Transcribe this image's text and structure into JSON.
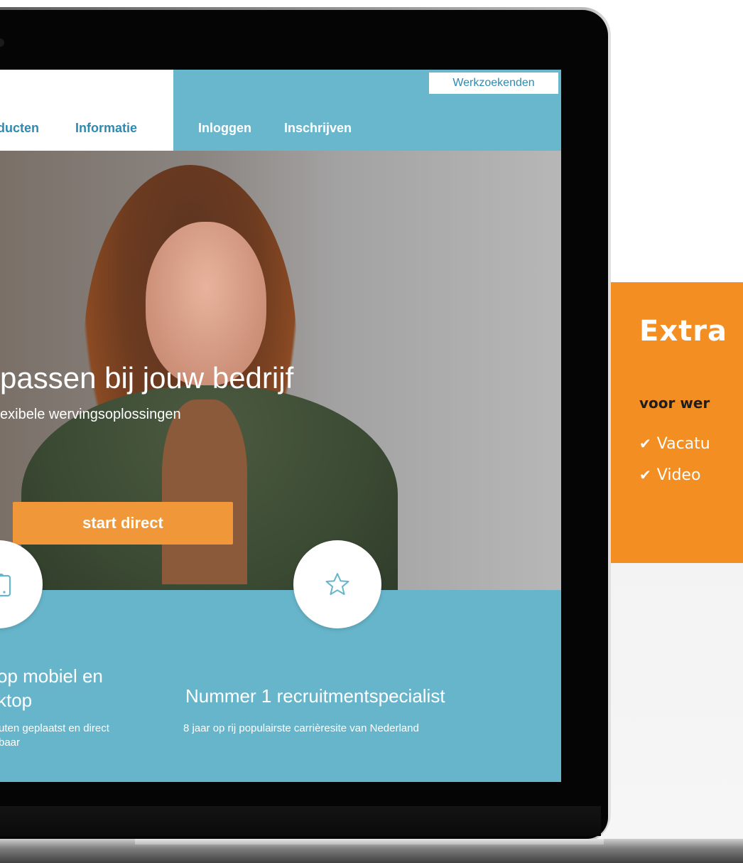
{
  "screen": {
    "nav": {
      "links_left": [
        "ducten",
        "Informatie"
      ],
      "links_right": [
        "Inloggen",
        "Inschrijven"
      ],
      "werkzoekenden_button": "Werkzoekenden"
    },
    "hero": {
      "title": "passen bij jouw bedrijf",
      "subtitle": "exibele wervingsoplossingen",
      "cta": "start direct"
    },
    "features": [
      {
        "title_line1": "op mobiel en",
        "title_line2": "ktop",
        "desc_line1": "uten geplaatst en direct",
        "desc_line2": "baar",
        "icon": "devices-icon"
      },
      {
        "title_line1": "Nummer 1 recruitmentspecialist",
        "desc_line1": "8 jaar op rij populairste carrièresite van Nederland",
        "icon": "star-icon"
      }
    ]
  },
  "side_panel": {
    "title": "Extra",
    "subtitle": "voor wer",
    "items": [
      "Vacatu",
      "Video"
    ],
    "check_icon": "check-icon"
  },
  "colors": {
    "nav_blue": "#69b7cd",
    "link_blue": "#2f8ab0",
    "orange_cta": "#f0973a",
    "orange_panel": "#f28e22",
    "band_blue": "#67b5cb"
  }
}
